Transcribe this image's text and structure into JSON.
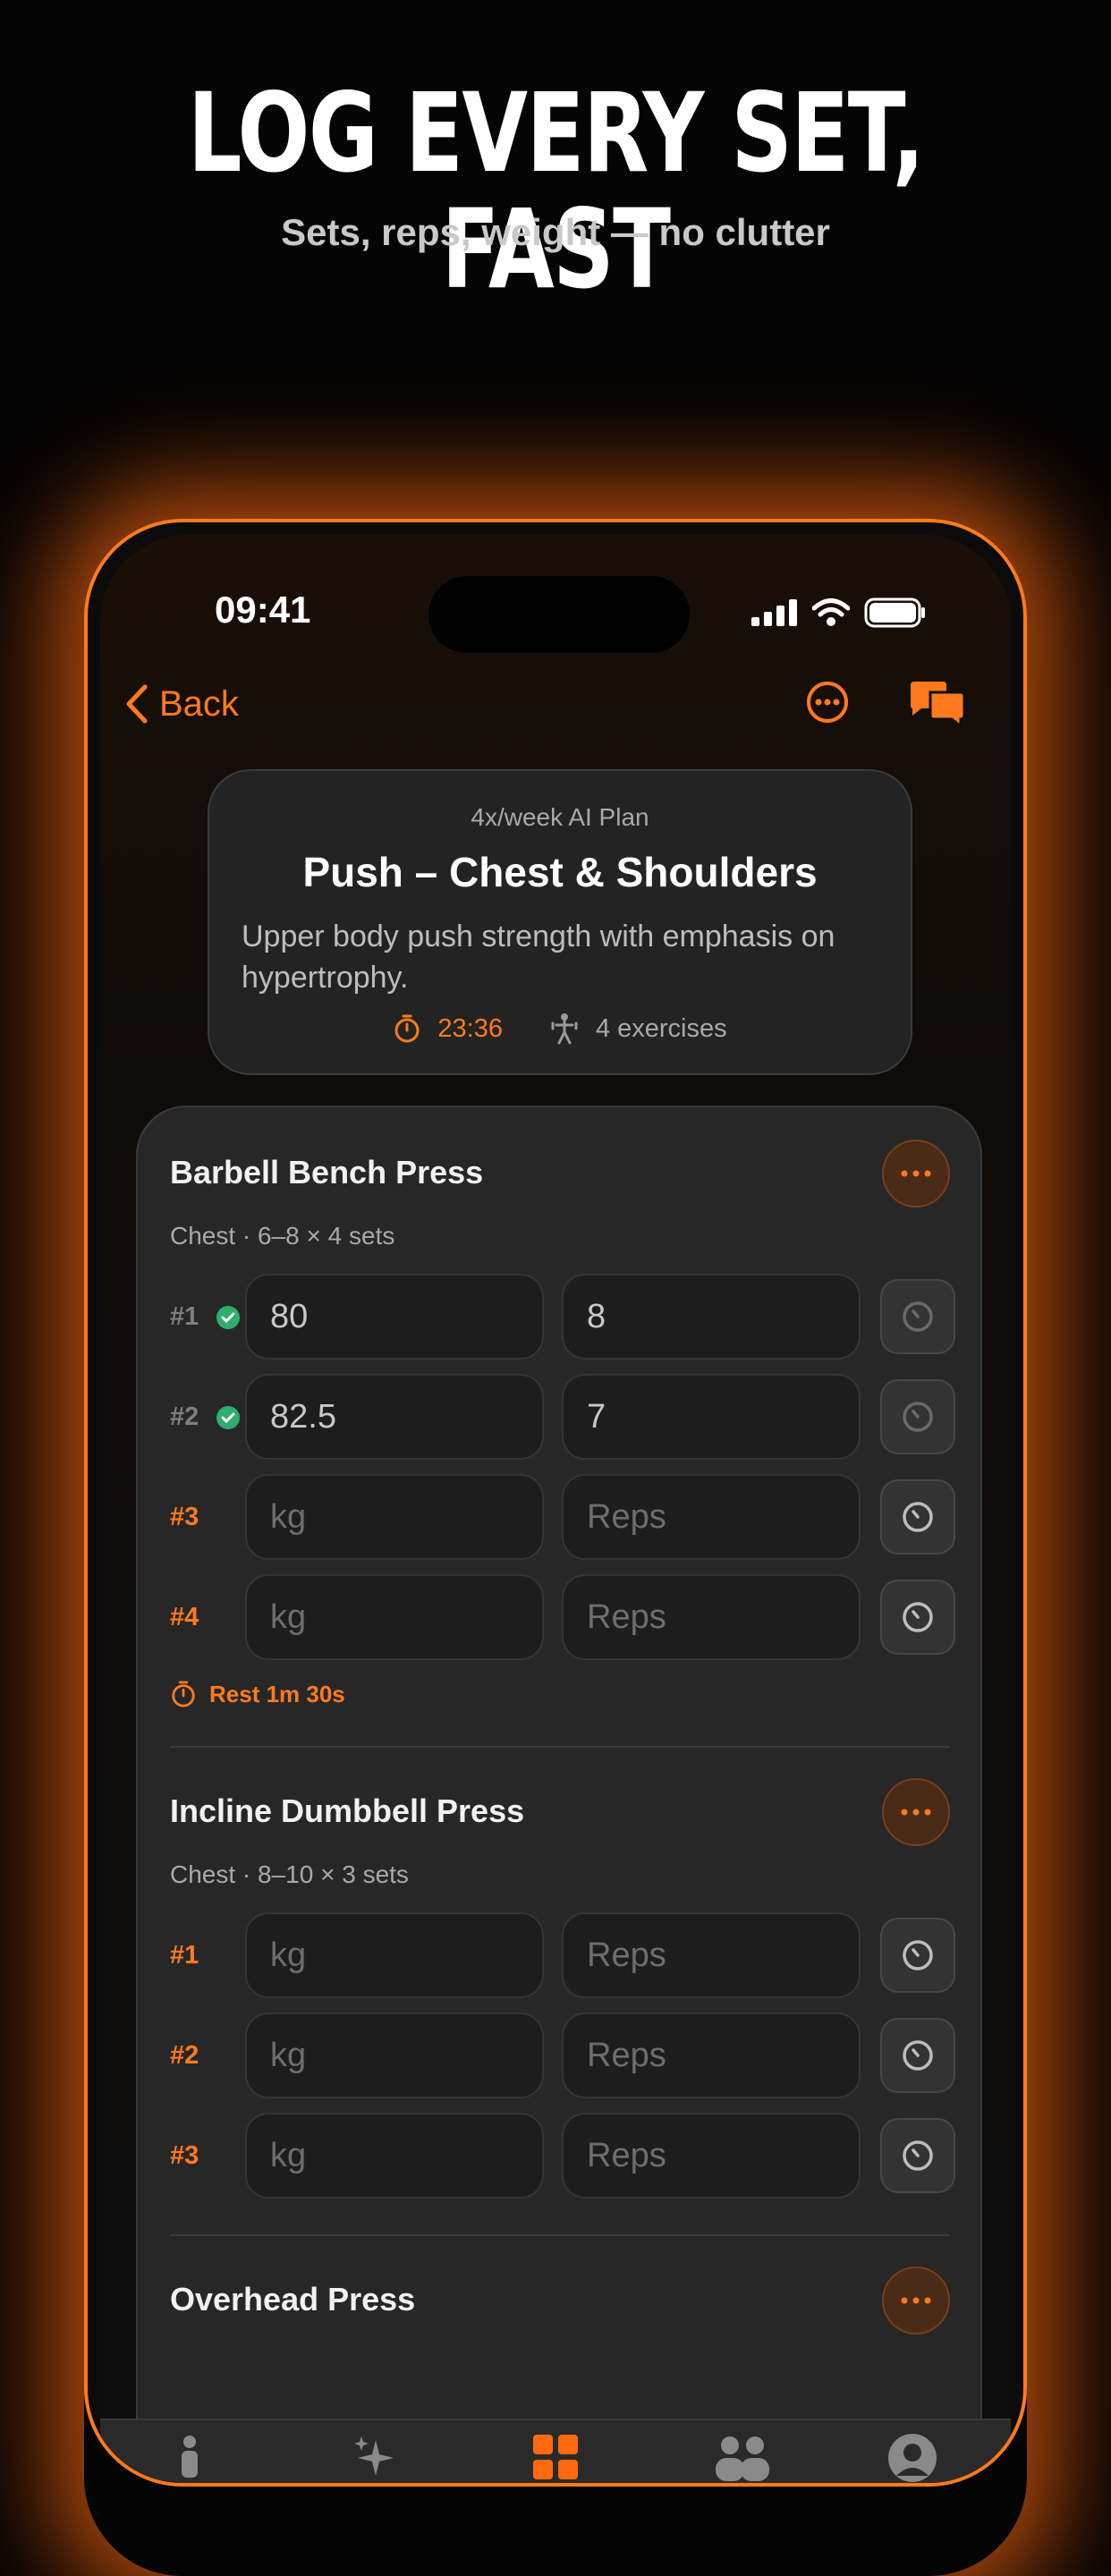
{
  "hero": {
    "title": "LOG EVERY SET, FAST",
    "subtitle": "Sets, reps, weight — no clutter"
  },
  "status_bar": {
    "time": "09:41",
    "icons": [
      "cellular-signal-icon",
      "wifi-icon",
      "battery-icon"
    ]
  },
  "nav": {
    "back_label": "Back",
    "more_icon": "more-icon",
    "chat_icon": "chat-bubbles-icon"
  },
  "plan": {
    "tag": "4x/week AI Plan",
    "title": "Push – Chest & Shoulders",
    "description": "Upper body push strength with emphasis on hypertrophy.",
    "duration": "23:36",
    "exercises_count": "4 exercises"
  },
  "exercises": [
    {
      "name": "Barbell Bench Press",
      "meta": "Chest · 6–8 × 4 sets",
      "sets": [
        {
          "label": "#1",
          "done": true,
          "kg": "80",
          "reps": "8"
        },
        {
          "label": "#2",
          "done": true,
          "kg": "82.5",
          "reps": "7"
        },
        {
          "label": "#3",
          "done": false,
          "kg": "",
          "reps": ""
        },
        {
          "label": "#4",
          "done": false,
          "kg": "",
          "reps": ""
        }
      ],
      "rest": "Rest 1m 30s"
    },
    {
      "name": "Incline Dumbbell Press",
      "meta": "Chest · 8–10 × 3 sets",
      "sets": [
        {
          "label": "#1",
          "done": false,
          "kg": "",
          "reps": ""
        },
        {
          "label": "#2",
          "done": false,
          "kg": "",
          "reps": ""
        },
        {
          "label": "#3",
          "done": false,
          "kg": "",
          "reps": ""
        }
      ]
    },
    {
      "name": "Overhead Press"
    }
  ],
  "placeholders": {
    "kg": "kg",
    "reps": "Reps"
  },
  "tabbar": {
    "items": [
      "person-icon",
      "sparkles-icon",
      "grid-icon",
      "group-icon",
      "profile-icon"
    ],
    "active_index": 2
  },
  "colors": {
    "accent": "#ff7a1c",
    "success": "#2fae6d",
    "background": "#050505",
    "card": "#272727"
  }
}
